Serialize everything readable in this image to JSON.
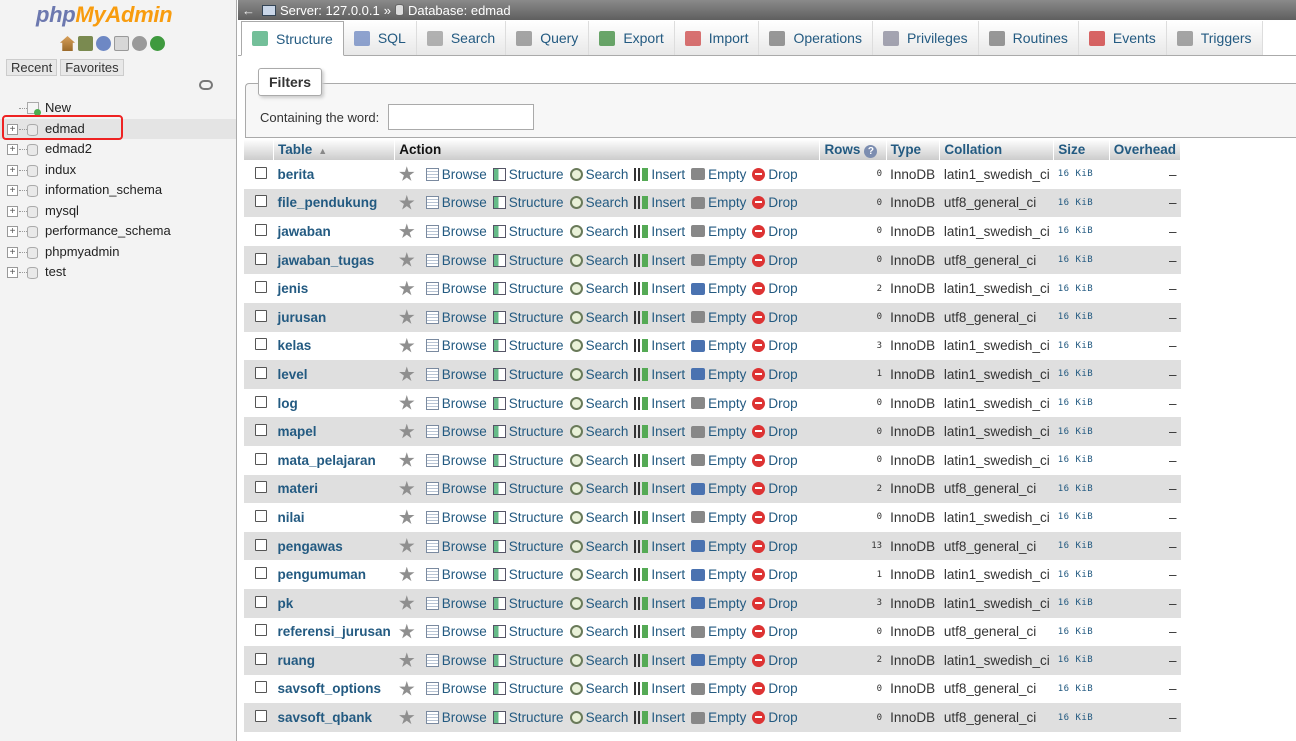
{
  "sidebar": {
    "logo_php": "php",
    "logo_myadmin": "MyAdmin",
    "tabs": [
      "Recent",
      "Favorites"
    ],
    "tree": [
      {
        "label": "New",
        "type": "new"
      },
      {
        "label": "edmad",
        "type": "db",
        "selected": true
      },
      {
        "label": "edmad2",
        "type": "db"
      },
      {
        "label": "indux",
        "type": "db"
      },
      {
        "label": "information_schema",
        "type": "db"
      },
      {
        "label": "mysql",
        "type": "db"
      },
      {
        "label": "performance_schema",
        "type": "db"
      },
      {
        "label": "phpmyadmin",
        "type": "db"
      },
      {
        "label": "test",
        "type": "db"
      }
    ]
  },
  "breadcrumb": {
    "server": "Server: 127.0.0.1",
    "sep": "»",
    "database": "Database: edmad"
  },
  "tabs": [
    {
      "label": "Structure",
      "icon": "structure-icon",
      "active": true
    },
    {
      "label": "SQL",
      "icon": "sql-icon"
    },
    {
      "label": "Search",
      "icon": "search-icon"
    },
    {
      "label": "Query",
      "icon": "query-icon"
    },
    {
      "label": "Export",
      "icon": "export-icon"
    },
    {
      "label": "Import",
      "icon": "import-icon"
    },
    {
      "label": "Operations",
      "icon": "wrench-icon"
    },
    {
      "label": "Privileges",
      "icon": "privileges-icon"
    },
    {
      "label": "Routines",
      "icon": "routines-icon"
    },
    {
      "label": "Events",
      "icon": "clock-icon"
    },
    {
      "label": "Triggers",
      "icon": "triggers-icon"
    }
  ],
  "filters": {
    "legend": "Filters",
    "label": "Containing the word:",
    "value": ""
  },
  "table": {
    "headers": {
      "table": "Table",
      "action": "Action",
      "rows": "Rows",
      "type": "Type",
      "collation": "Collation",
      "size": "Size",
      "overhead": "Overhead"
    },
    "actions": [
      "Browse",
      "Structure",
      "Search",
      "Insert",
      "Empty",
      "Drop"
    ],
    "rows": [
      {
        "name": "berita",
        "rows": "0",
        "type": "InnoDB",
        "collation": "latin1_swedish_ci",
        "size": "16 KiB",
        "overhead": "–"
      },
      {
        "name": "file_pendukung",
        "rows": "0",
        "type": "InnoDB",
        "collation": "utf8_general_ci",
        "size": "16 KiB",
        "overhead": "–"
      },
      {
        "name": "jawaban",
        "rows": "0",
        "type": "InnoDB",
        "collation": "latin1_swedish_ci",
        "size": "16 KiB",
        "overhead": "–"
      },
      {
        "name": "jawaban_tugas",
        "rows": "0",
        "type": "InnoDB",
        "collation": "utf8_general_ci",
        "size": "16 KiB",
        "overhead": "–"
      },
      {
        "name": "jenis",
        "rows": "2",
        "type": "InnoDB",
        "collation": "latin1_swedish_ci",
        "size": "16 KiB",
        "overhead": "–"
      },
      {
        "name": "jurusan",
        "rows": "0",
        "type": "InnoDB",
        "collation": "utf8_general_ci",
        "size": "16 KiB",
        "overhead": "–"
      },
      {
        "name": "kelas",
        "rows": "3",
        "type": "InnoDB",
        "collation": "latin1_swedish_ci",
        "size": "16 KiB",
        "overhead": "–"
      },
      {
        "name": "level",
        "rows": "1",
        "type": "InnoDB",
        "collation": "latin1_swedish_ci",
        "size": "16 KiB",
        "overhead": "–"
      },
      {
        "name": "log",
        "rows": "0",
        "type": "InnoDB",
        "collation": "latin1_swedish_ci",
        "size": "16 KiB",
        "overhead": "–"
      },
      {
        "name": "mapel",
        "rows": "0",
        "type": "InnoDB",
        "collation": "latin1_swedish_ci",
        "size": "16 KiB",
        "overhead": "–"
      },
      {
        "name": "mata_pelajaran",
        "rows": "0",
        "type": "InnoDB",
        "collation": "latin1_swedish_ci",
        "size": "16 KiB",
        "overhead": "–"
      },
      {
        "name": "materi",
        "rows": "2",
        "type": "InnoDB",
        "collation": "utf8_general_ci",
        "size": "16 KiB",
        "overhead": "–"
      },
      {
        "name": "nilai",
        "rows": "0",
        "type": "InnoDB",
        "collation": "latin1_swedish_ci",
        "size": "16 KiB",
        "overhead": "–"
      },
      {
        "name": "pengawas",
        "rows": "13",
        "type": "InnoDB",
        "collation": "utf8_general_ci",
        "size": "16 KiB",
        "overhead": "–"
      },
      {
        "name": "pengumuman",
        "rows": "1",
        "type": "InnoDB",
        "collation": "latin1_swedish_ci",
        "size": "16 KiB",
        "overhead": "–"
      },
      {
        "name": "pk",
        "rows": "3",
        "type": "InnoDB",
        "collation": "latin1_swedish_ci",
        "size": "16 KiB",
        "overhead": "–"
      },
      {
        "name": "referensi_jurusan",
        "rows": "0",
        "type": "InnoDB",
        "collation": "utf8_general_ci",
        "size": "16 KiB",
        "overhead": "–"
      },
      {
        "name": "ruang",
        "rows": "2",
        "type": "InnoDB",
        "collation": "latin1_swedish_ci",
        "size": "16 KiB",
        "overhead": "–"
      },
      {
        "name": "savsoft_options",
        "rows": "0",
        "type": "InnoDB",
        "collation": "utf8_general_ci",
        "size": "16 KiB",
        "overhead": "–"
      },
      {
        "name": "savsoft_qbank",
        "rows": "0",
        "type": "InnoDB",
        "collation": "utf8_general_ci",
        "size": "16 KiB",
        "overhead": "–"
      }
    ]
  },
  "colors": {
    "link": "#235a81",
    "logo_php": "#6c78af",
    "logo_myadmin": "#f89c0e",
    "row_alt": "#dfdfdf",
    "drop": "#dd3333"
  }
}
